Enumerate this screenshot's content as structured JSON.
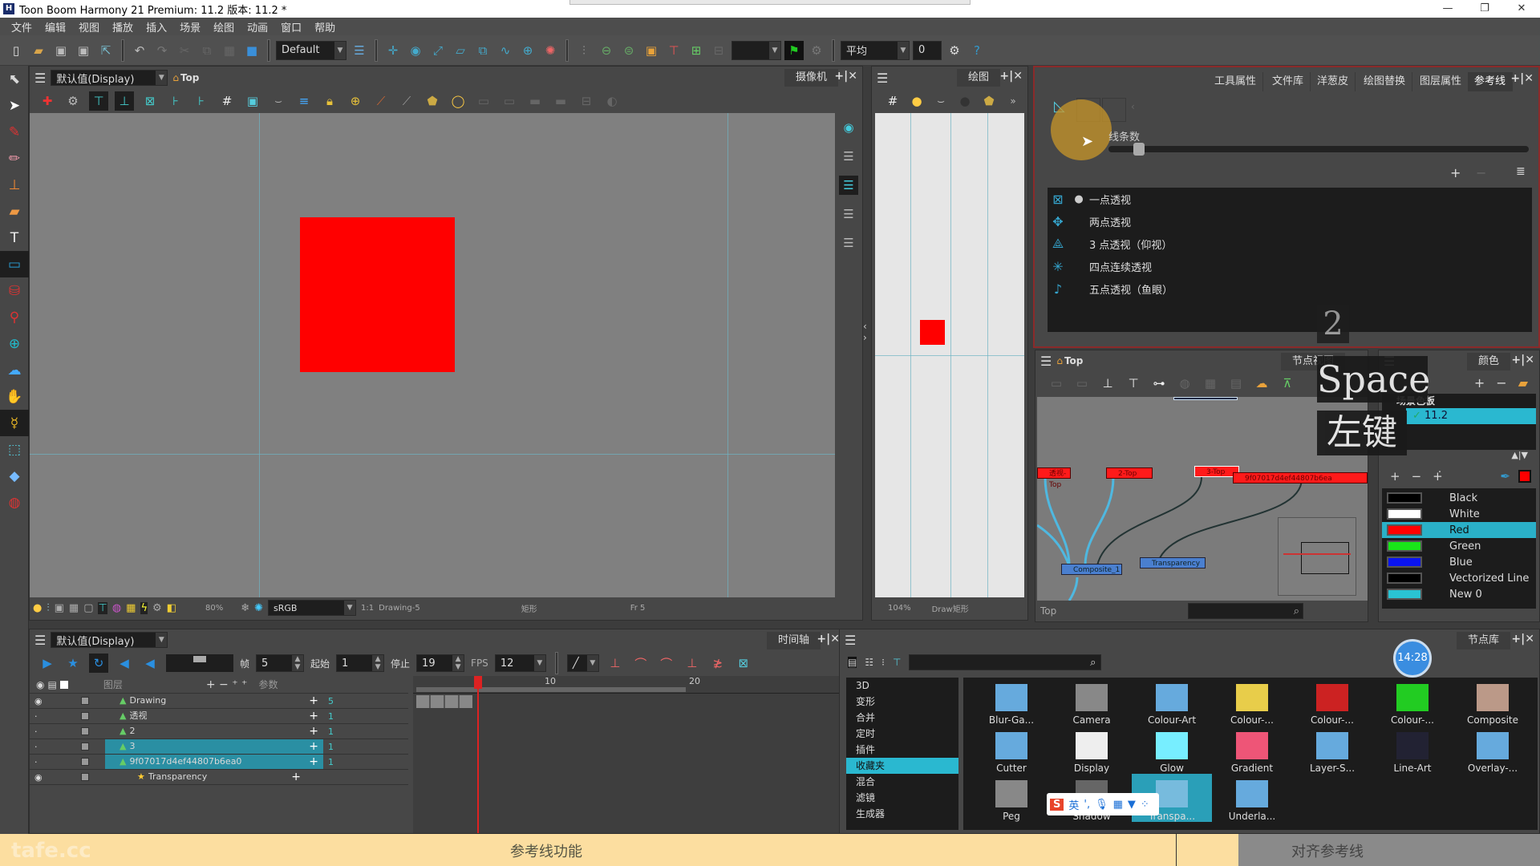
{
  "window": {
    "title": "Toon Boom Harmony 21 Premium: 11.2 版本: 11.2 *",
    "minimize": "—",
    "restore": "❐",
    "close": "✕"
  },
  "menu": [
    "文件",
    "编辑",
    "视图",
    "播放",
    "插入",
    "场景",
    "绘图",
    "动画",
    "窗口",
    "帮助"
  ],
  "toolbar": {
    "workspace": "Default",
    "smoothing": "平均",
    "smoothing_value": "0"
  },
  "camera": {
    "tab": "摄像机",
    "display": "默认值(Display)",
    "view": "Top",
    "status": {
      "zoom": "80%",
      "colorspace": "sRGB",
      "ratio": "1:1",
      "drawing": "Drawing-5",
      "tool": "矩形",
      "frame": "Fr 5"
    }
  },
  "drawing": {
    "tab": "绘图",
    "zoom": "104%",
    "status": "Draw矩形"
  },
  "reference": {
    "tabs": [
      "工具属性",
      "文件库",
      "洋葱皮",
      "绘图替换",
      "图层属性",
      "参考线"
    ],
    "active_tab": "参考线",
    "slider_label": "线条数",
    "slider_value": 0.06,
    "guides": [
      {
        "label": "一点透视",
        "icon": "one-point-perspective-icon",
        "selected": true
      },
      {
        "label": "两点透视",
        "icon": "two-point-perspective-icon",
        "selected": false
      },
      {
        "label": "3 点透视（仰视）",
        "icon": "three-point-perspective-icon",
        "selected": false
      },
      {
        "label": "四点连续透视",
        "icon": "four-point-perspective-icon",
        "selected": false
      },
      {
        "label": "五点透视（鱼眼）",
        "icon": "fisheye-perspective-icon",
        "selected": false
      }
    ]
  },
  "nodeview": {
    "tab": "节点视图",
    "view": "Top",
    "status": "Top",
    "nodes": [
      "透视-Top",
      "2-Top",
      "3-Top",
      "9f07017d4ef44807b6ea",
      "Composite_1",
      "Transparency"
    ]
  },
  "overlay": {
    "number": "2",
    "key1": "Space",
    "key2": "左键"
  },
  "colors": {
    "tab": "颜色",
    "palette_header": "场景色板",
    "palette": "11.2",
    "swatches": [
      {
        "name": "Black",
        "color": "#000000"
      },
      {
        "name": "White",
        "color": "#ffffff"
      },
      {
        "name": "Red",
        "color": "#ff0000",
        "selected": true
      },
      {
        "name": "Green",
        "color": "#19e619"
      },
      {
        "name": "Blue",
        "color": "#0a14f0"
      },
      {
        "name": "Vectorized Line",
        "color": "#000000"
      },
      {
        "name": "New 0",
        "color": "#2ac3d3"
      }
    ],
    "current": "#ff0000"
  },
  "timeline": {
    "tab": "时间轴",
    "display": "默认值(Display)",
    "frame_label": "帧",
    "frame": "5",
    "start_label": "起始",
    "start": "1",
    "stop_label": "停止",
    "stop": "19",
    "fps_label": "FPS",
    "fps": "12",
    "layers_header": "图层",
    "params_header": "参数",
    "ruler": [
      "10",
      "20"
    ],
    "layers": [
      {
        "name": "Drawing",
        "value": "5",
        "selected": false
      },
      {
        "name": "透视",
        "value": "1",
        "selected": false
      },
      {
        "name": "2",
        "value": "1",
        "selected": false
      },
      {
        "name": "3",
        "value": "1",
        "selected": true
      },
      {
        "name": "9f07017d4ef44807b6ea0",
        "value": "1",
        "selected": true
      },
      {
        "name": "Transparency",
        "value": "",
        "selected": false
      }
    ]
  },
  "library": {
    "tab": "节点库",
    "clock": "14:28",
    "categories": [
      "3D",
      "变形",
      "合并",
      "定时",
      "插件",
      "收藏夹",
      "混合",
      "滤镜",
      "生成器"
    ],
    "selected_category": "收藏夹",
    "items": [
      "Blur-Ga...",
      "Camera",
      "Colour-Art",
      "Colour-...",
      "Colour-...",
      "Colour-...",
      "Composite",
      "Cutter",
      "Display",
      "Glow",
      "Gradient",
      "Layer-S...",
      "Line-Art",
      "Overlay-...",
      "Peg",
      "Shadow",
      "Transpa...",
      "Underla..."
    ],
    "selected_item": "Transpa..."
  },
  "ime": {
    "mode": "英"
  },
  "caption": {
    "left": "参考线功能",
    "right": "对齐参考线",
    "watermark": "tafe.cc"
  }
}
